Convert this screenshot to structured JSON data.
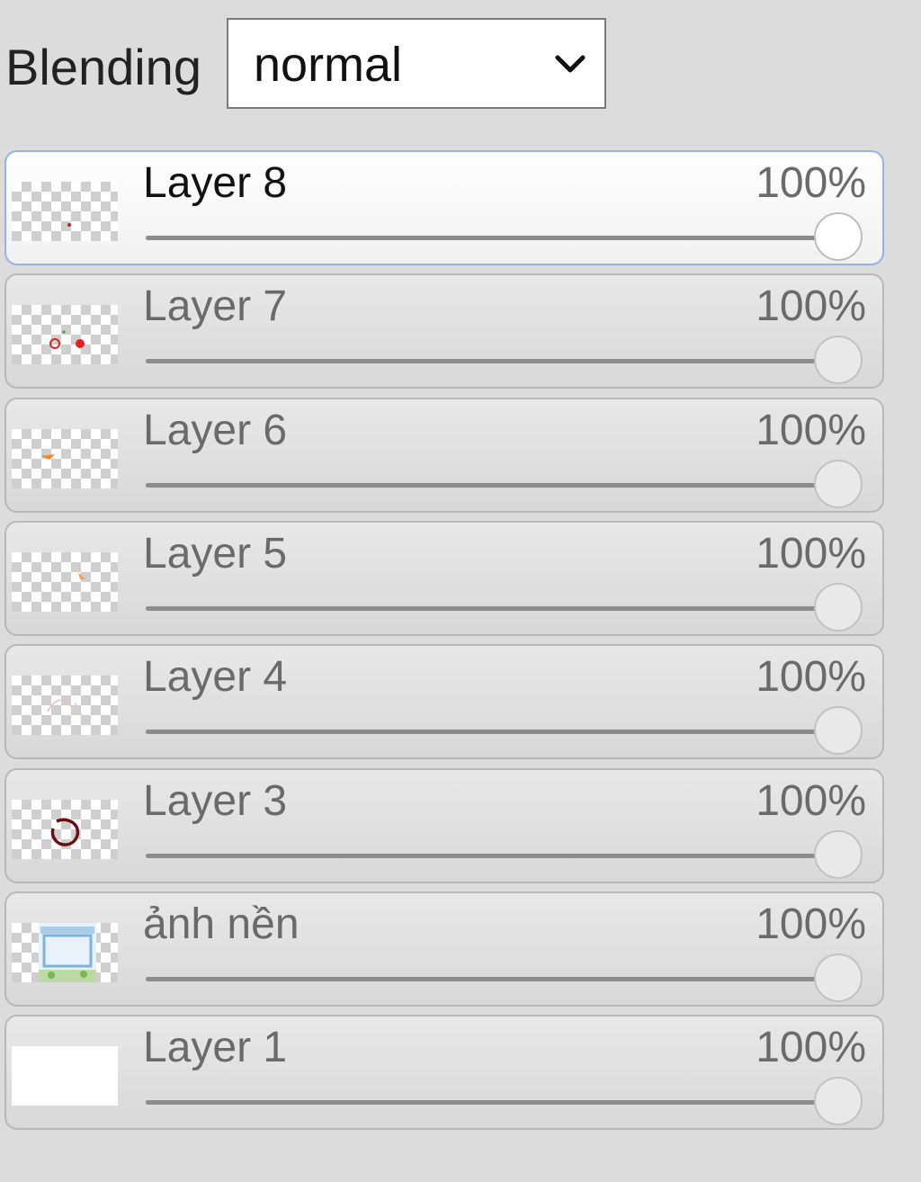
{
  "blending": {
    "label": "Blending",
    "value": "normal",
    "icon": "chevron-down-icon"
  },
  "layers": [
    {
      "name": "Layer 8",
      "opacity_label": "100%",
      "opacity": 1.0,
      "selected": true,
      "thumb": "red-dot"
    },
    {
      "name": "Layer 7",
      "opacity_label": "100%",
      "opacity": 1.0,
      "selected": false,
      "thumb": "red-dots"
    },
    {
      "name": "Layer 6",
      "opacity_label": "100%",
      "opacity": 1.0,
      "selected": false,
      "thumb": "orange-mark"
    },
    {
      "name": "Layer 5",
      "opacity_label": "100%",
      "opacity": 1.0,
      "selected": false,
      "thumb": "orange-dot"
    },
    {
      "name": "Layer 4",
      "opacity_label": "100%",
      "opacity": 1.0,
      "selected": false,
      "thumb": "faint-sketch"
    },
    {
      "name": "Layer 3",
      "opacity_label": "100%",
      "opacity": 1.0,
      "selected": false,
      "thumb": "dark-red-ring"
    },
    {
      "name": "ảnh nền",
      "opacity_label": "100%",
      "opacity": 1.0,
      "selected": false,
      "thumb": "background-scene"
    },
    {
      "name": "Layer 1",
      "opacity_label": "100%",
      "opacity": 1.0,
      "selected": false,
      "thumb": "white"
    }
  ],
  "colors": {
    "selected_border": "#8fb4ef",
    "row_border": "#b8b8b8",
    "page_background": "#dcdcdc"
  }
}
